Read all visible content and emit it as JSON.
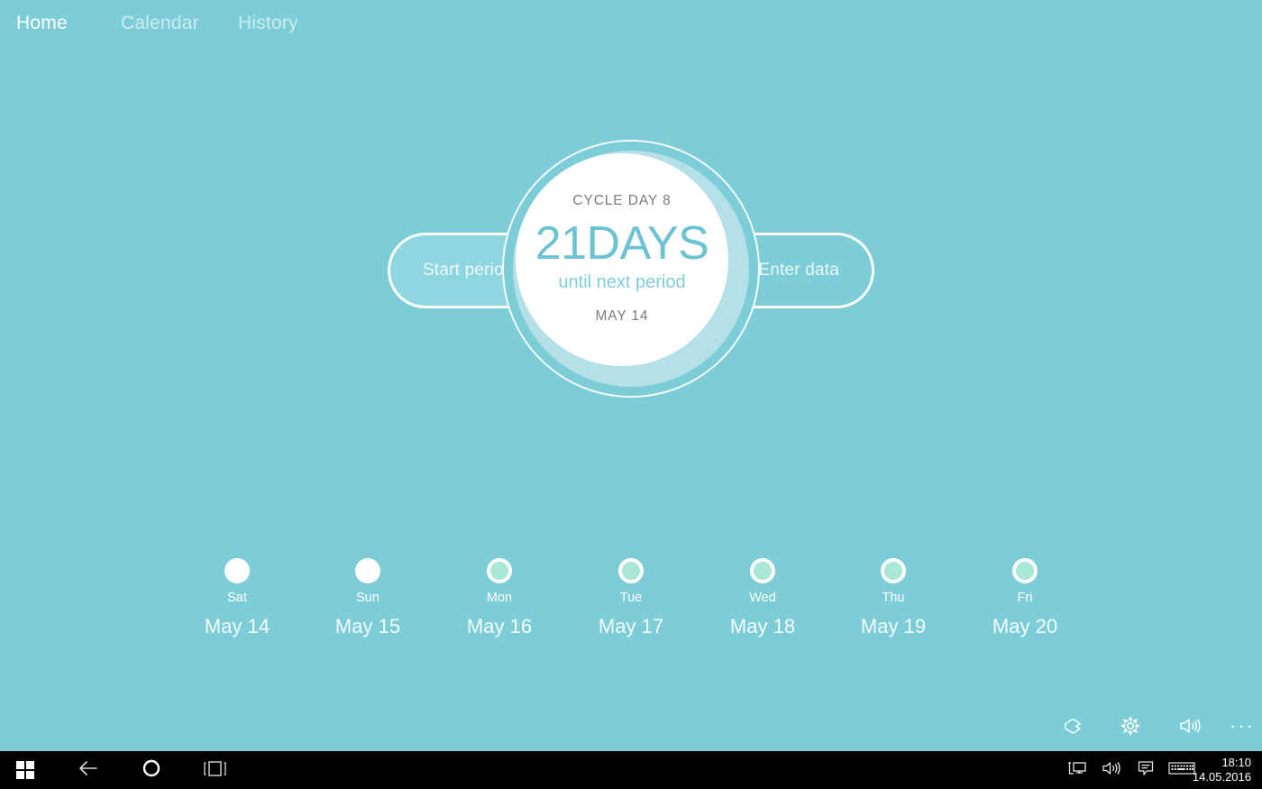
{
  "colors": {
    "background": "#7ccdd8",
    "accent_teal": "#6cc4d3",
    "halo": "#b4e0e7",
    "pill_start_fill": "#8ed6e0",
    "dot_fill_mint": "#a9e7d7",
    "text_gray": "#7a7a7a",
    "white": "#ffffff",
    "taskbar": "#000000"
  },
  "nav": {
    "items": [
      {
        "label": "Home",
        "active": true,
        "name": "nav-home"
      },
      {
        "label": "Calendar",
        "active": false,
        "name": "nav-calendar"
      },
      {
        "label": "History",
        "active": false,
        "name": "nav-history"
      }
    ]
  },
  "hero": {
    "start_period_button": "Start period",
    "enter_data_button": "Enter data",
    "cycle_day_label": "CYCLE DAY  8",
    "days_value": "21DAYS",
    "days_caption": "until next period",
    "next_period_date": "MAY 14"
  },
  "week": {
    "days": [
      {
        "dow": "Sat",
        "date": "May 14",
        "style": "solid"
      },
      {
        "dow": "Sun",
        "date": "May 15",
        "style": "solid"
      },
      {
        "dow": "Mon",
        "date": "May 16",
        "style": "ring"
      },
      {
        "dow": "Tue",
        "date": "May 17",
        "style": "ring"
      },
      {
        "dow": "Wed",
        "date": "May 18",
        "style": "ring"
      },
      {
        "dow": "Thu",
        "date": "May 19",
        "style": "ring"
      },
      {
        "dow": "Fri",
        "date": "May 20",
        "style": "ring"
      }
    ]
  },
  "appbar": {
    "buttons": [
      {
        "icon": "tag-icon",
        "label": ""
      },
      {
        "icon": "gear-icon",
        "label": ""
      },
      {
        "icon": "speaker-icon",
        "label": ""
      },
      {
        "icon": "more-icon",
        "label": "···"
      }
    ]
  },
  "taskbar": {
    "start": "windows-logo-icon",
    "back": "back-arrow-icon",
    "cortana": "cortana-circle-icon",
    "taskview": "task-view-icon",
    "network": "network-icon",
    "volume": "volume-icon",
    "notifications": "action-center-icon",
    "keyboard": "keyboard-icon",
    "time": "18:10",
    "date": "14.05.2016"
  }
}
